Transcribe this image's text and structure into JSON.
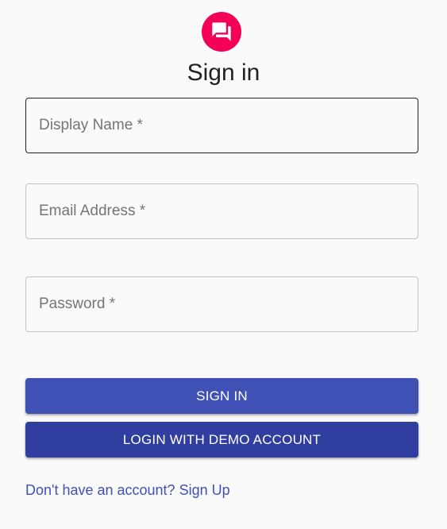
{
  "header": {
    "title": "Sign in",
    "avatar_icon": "forum-icon",
    "avatar_color": "#f50057"
  },
  "form": {
    "display_name_label": "Display Name *",
    "email_label": "Email Address *",
    "password_label": "Password *"
  },
  "actions": {
    "sign_in_label": "SIGN IN",
    "sign_in_color": "#3f51b5",
    "demo_label": "LOGIN WITH DEMO ACCOUNT",
    "demo_color": "#303f9f",
    "signup_link": "Don't have an account? Sign Up"
  }
}
